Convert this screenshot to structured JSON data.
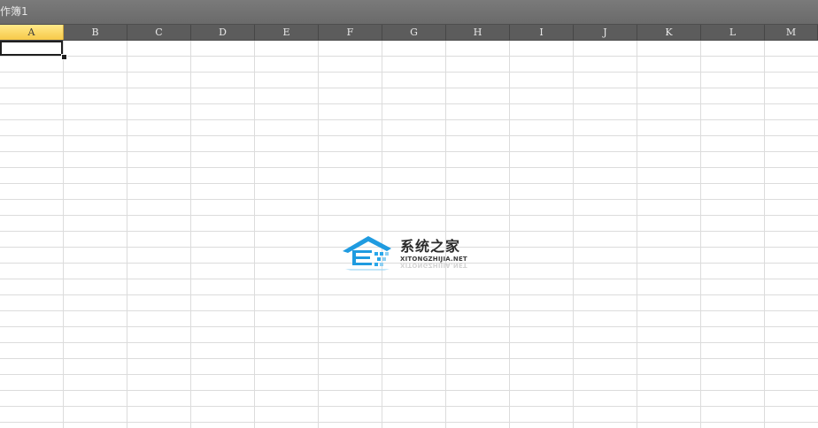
{
  "window": {
    "title": "作簿1"
  },
  "sheet": {
    "columns": [
      "A",
      "B",
      "C",
      "D",
      "E",
      "F",
      "G",
      "H",
      "I",
      "J",
      "K",
      "L",
      "M"
    ],
    "active_column": "A",
    "active_cell": "A1",
    "row_count_visible": 24
  },
  "watermark": {
    "brand_cn": "系统之家",
    "brand_en": "XITONGZHIJIA.NET",
    "icon": "house-logo-icon",
    "accent_color": "#1f9be0"
  },
  "colors": {
    "titlebar": "#6e6e6e",
    "header_bar": "#5c5c5c",
    "active_header": "#f7c948",
    "grid_line": "#dcdcdc"
  }
}
